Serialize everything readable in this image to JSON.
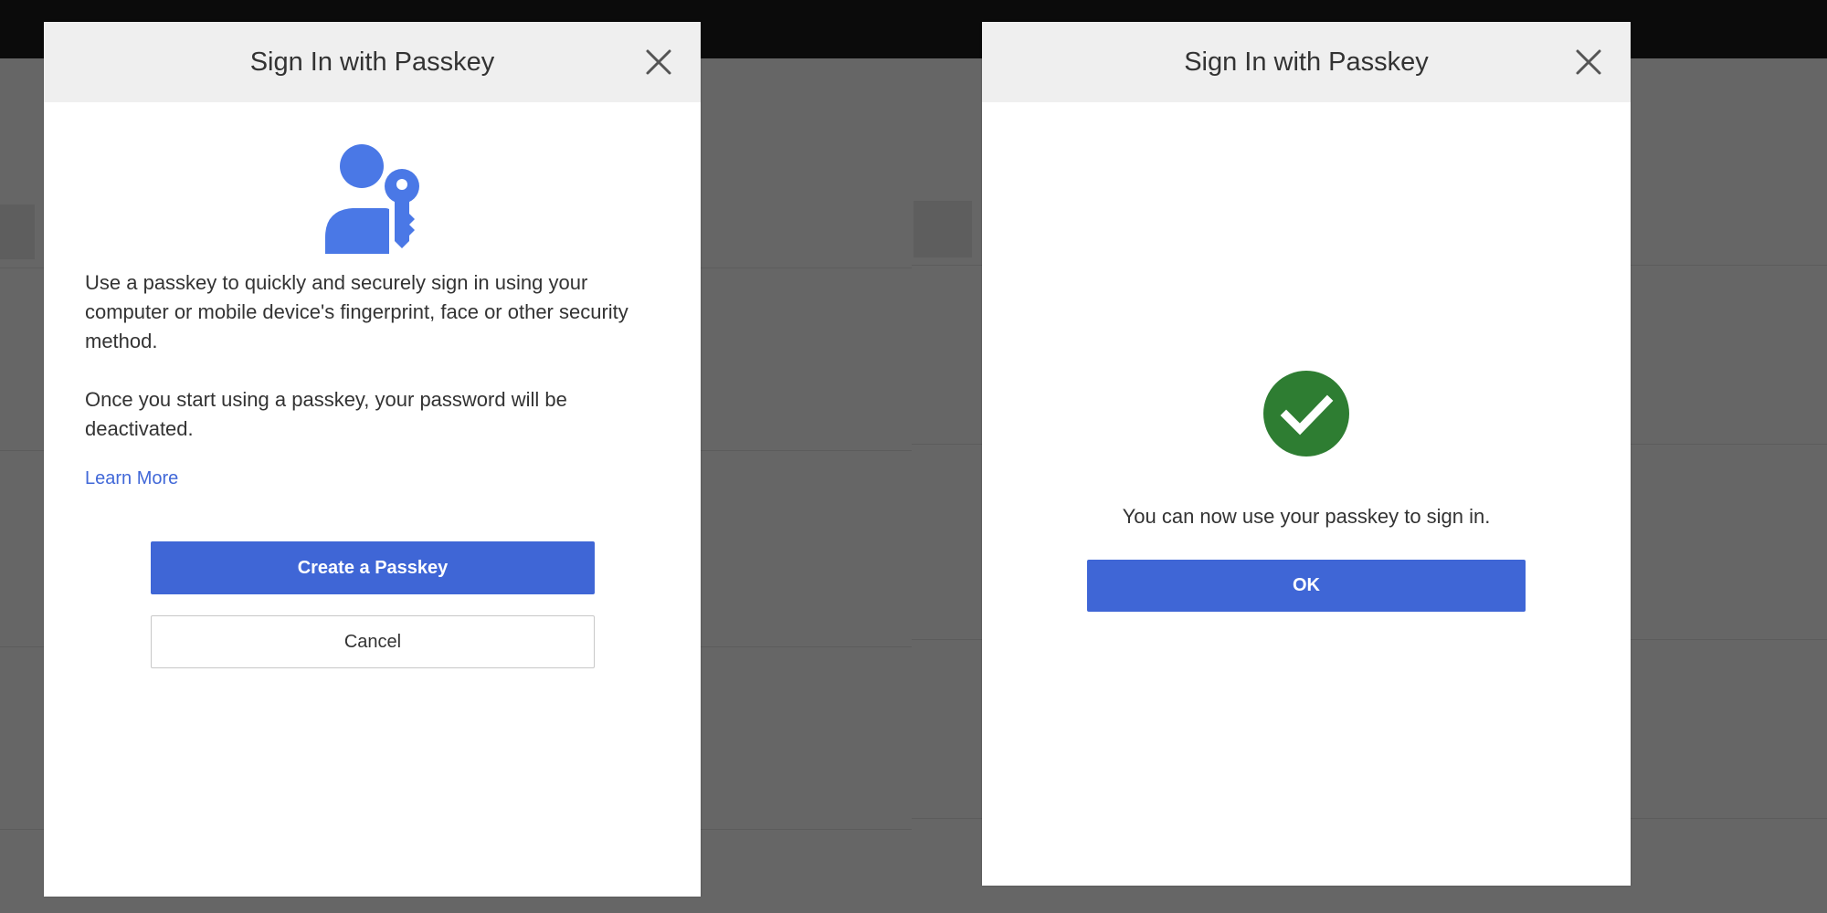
{
  "colors": {
    "primary": "#3f66d6",
    "success": "#2e7d32",
    "link": "#4168d8",
    "icon_blue": "#4a78e6",
    "overlay": "#666666",
    "header_bg": "#efefef"
  },
  "dialog_create": {
    "title": "Sign In with Passkey",
    "close_icon": "close-icon",
    "illustration_icon": "user-key-icon",
    "description_1": "Use a passkey to quickly and securely sign in using your computer or mobile device's fingerprint, face or other security method.",
    "description_2": "Once you start using a passkey, your password will be deactivated.",
    "learn_more_label": "Learn More",
    "create_button_label": "Create a Passkey",
    "cancel_button_label": "Cancel"
  },
  "dialog_success": {
    "title": "Sign In with Passkey",
    "close_icon": "close-icon",
    "status_icon": "check-circle-icon",
    "message": "You can now use your passkey to sign in.",
    "ok_button_label": "OK"
  }
}
